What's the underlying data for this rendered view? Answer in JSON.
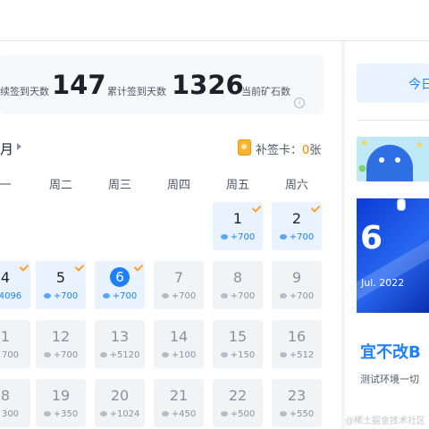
{
  "stats": {
    "streak_label": "续签到天数",
    "streak": "147",
    "total_label": "累计签到天数",
    "total": "1326",
    "ore_label": "当前矿石数"
  },
  "calendar": {
    "month": "月",
    "card_label": "补签卡：",
    "card_count": "0",
    "card_unit": "张",
    "weekdays": [
      "一",
      "周二",
      "周三",
      "周四",
      "周五",
      "周六"
    ],
    "rows": [
      [
        null,
        null,
        null,
        null,
        {
          "day": "1",
          "pts": "+700",
          "state": "past"
        },
        {
          "day": "2",
          "pts": "+700",
          "state": "past"
        }
      ],
      [
        {
          "day": "4",
          "pts": "4096",
          "state": "past"
        },
        {
          "day": "5",
          "pts": "+700",
          "state": "past"
        },
        {
          "day": "6",
          "pts": "+700",
          "state": "today"
        },
        {
          "day": "7",
          "pts": "+700",
          "state": "future"
        },
        {
          "day": "8",
          "pts": "+700",
          "state": "future"
        },
        {
          "day": "9",
          "pts": "+700",
          "state": "future"
        }
      ],
      [
        {
          "day": "1",
          "pts": "700",
          "state": "future"
        },
        {
          "day": "12",
          "pts": "+700",
          "state": "future"
        },
        {
          "day": "13",
          "pts": "+5120",
          "state": "future"
        },
        {
          "day": "14",
          "pts": "+100",
          "state": "future"
        },
        {
          "day": "15",
          "pts": "+150",
          "state": "future"
        },
        {
          "day": "16",
          "pts": "+512",
          "state": "future"
        }
      ],
      [
        {
          "day": "8",
          "pts": "300",
          "state": "future"
        },
        {
          "day": "19",
          "pts": "+350",
          "state": "future"
        },
        {
          "day": "20",
          "pts": "+1024",
          "state": "future"
        },
        {
          "day": "21",
          "pts": "+450",
          "state": "future"
        },
        {
          "day": "22",
          "pts": "+500",
          "state": "future"
        },
        {
          "day": "23",
          "pts": "+550",
          "state": "future"
        }
      ]
    ]
  },
  "sidebar": {
    "today_btn": "今日",
    "date_day": "6",
    "date_month": "Jul. 2022",
    "motto": "宜不改B",
    "subtext": "测试环境一切",
    "watermark": "@稀土掘金技术社区"
  },
  "colors": {
    "accent": "#1e80ff",
    "orange": "#ff7d00"
  }
}
